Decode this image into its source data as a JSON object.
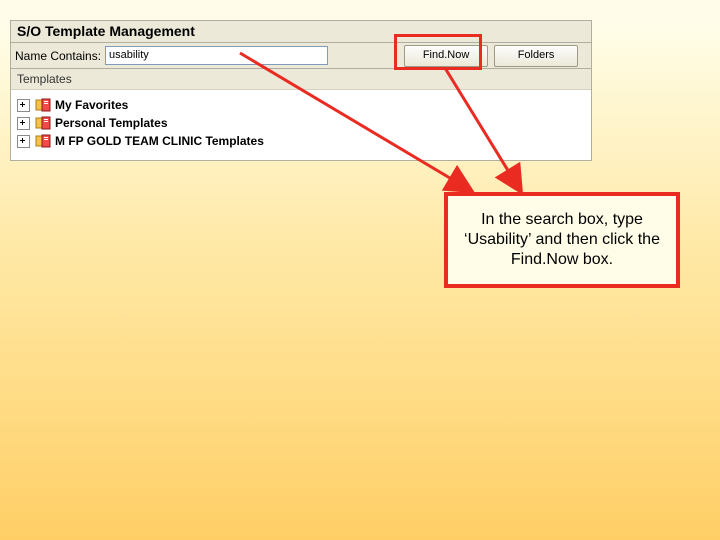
{
  "window": {
    "title": "S/O Template Management",
    "name_contains_label": "Name Contains:",
    "name_contains_value": "usability",
    "find_now_label": "Find.Now",
    "folders_label": "Folders",
    "templates_header": "Templates",
    "tree_items": [
      "My Favorites",
      "Personal Templates",
      "M FP GOLD TEAM CLINIC Templates"
    ]
  },
  "callout": {
    "text": "In the search box, type ‘Usability’ and then click the Find.Now box."
  },
  "highlight": {
    "target": "find-now-button"
  },
  "arrows": [
    {
      "from": "search-input",
      "to": "callout-box"
    },
    {
      "from": "find-now-button",
      "to": "callout-box"
    }
  ]
}
